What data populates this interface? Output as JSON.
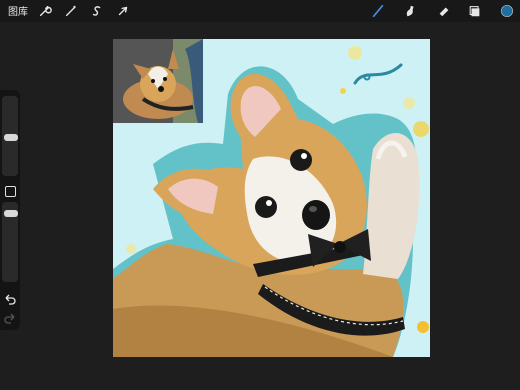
{
  "toolbar": {
    "gallery_label": "图库",
    "tools": [
      {
        "name": "actions",
        "icon": "wrench-icon"
      },
      {
        "name": "adjustments",
        "icon": "magic-wand-icon"
      },
      {
        "name": "selection",
        "icon": "selection-s-icon"
      },
      {
        "name": "transform",
        "icon": "arrow-cursor-icon"
      }
    ],
    "right_tools": [
      {
        "name": "brush",
        "icon": "brush-icon"
      },
      {
        "name": "smudge",
        "icon": "smudge-icon"
      },
      {
        "name": "eraser",
        "icon": "eraser-icon"
      },
      {
        "name": "layers",
        "icon": "layers-icon"
      },
      {
        "name": "color",
        "icon": "color-swatch"
      }
    ],
    "active_color": "#1f6fa0",
    "active_tool_color": "#3d8fe0"
  },
  "sidebar": {
    "brush_size_level": 0.45,
    "opacity_level": 0.75
  },
  "canvas": {
    "background_color": "#cdf1f5",
    "outline_color": "#3fb0b8"
  }
}
